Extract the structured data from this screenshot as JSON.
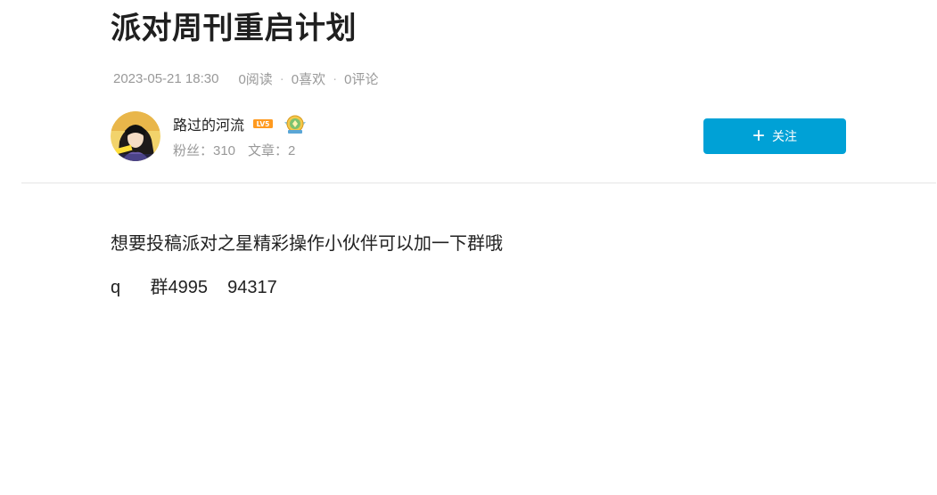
{
  "article": {
    "title": "派对周刊重启计划",
    "date": "2023-05-21 18:30",
    "reads": "0阅读",
    "likes": "0喜欢",
    "comments": "0评论",
    "separator": "·"
  },
  "author": {
    "name": "路过的河流",
    "level_badge": "LV5",
    "fans": "粉丝：310",
    "articles": "文章：2",
    "avatar_icon": "avatar-image",
    "medal_icon": "medal-icon"
  },
  "follow_button": {
    "label": "关注",
    "color": "#00a1d6"
  },
  "content": {
    "paragraphs": [
      "想要投稿派对之星精彩操作小伙伴可以加一下群哦",
      "q      群4995    94317"
    ]
  }
}
